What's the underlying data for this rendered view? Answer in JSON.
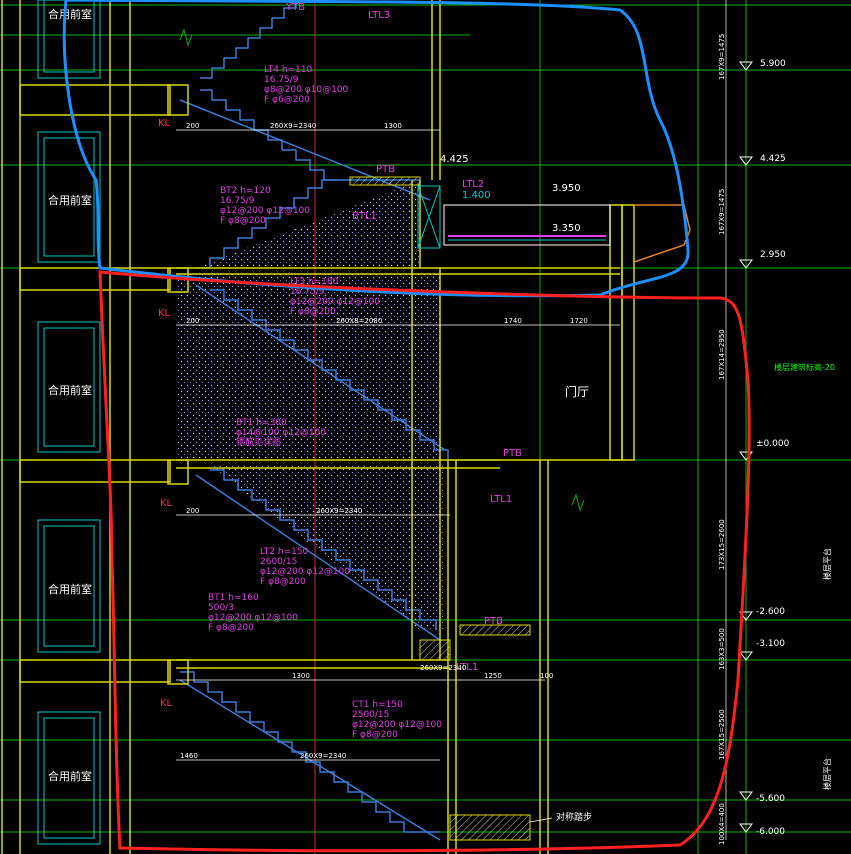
{
  "room_label": "合用前室",
  "hall_label": "门厅",
  "elevations": [
    "5.900",
    "4.425",
    "2.950",
    "±0.000",
    "-2.600",
    "-3.100",
    "-5.600",
    "-6.000"
  ],
  "inner_levels": [
    "4.425",
    "3.950",
    "3.350",
    "1.400"
  ],
  "beam_labels": {
    "ytb": "YTB",
    "ltl3": "LTL3",
    "ptb_upper": "PTB",
    "ltl2": "LTL2",
    "btl1": "BTL1",
    "ptb_mid": "PTB",
    "ltl1_mid": "LTL1",
    "ptb_low": "PTB",
    "ltl1_low": "LTL1",
    "kl": "KL"
  },
  "stair_notes": {
    "lt4": [
      "LT4 h=110",
      "16.75/9",
      "φ8@200 φ10@100",
      "F φ6@200"
    ],
    "bt2": [
      "BT2 h=120",
      "16.75/9",
      "φ12@200 φ12@100",
      "F φ8@200"
    ],
    "lt3": [
      "LT3 h=180",
      "16.75/9",
      "φ12@200 φ12@100",
      "F φ8@200"
    ],
    "bt1a": [
      "BT1 h=300",
      "φ14@100 φ12@100",
      "钢筋见详图"
    ],
    "lt2": [
      "LT2 h=150",
      "2600/15",
      "φ12@200 φ12@100",
      "F φ8@200"
    ],
    "bt1": [
      "BT1 h=160",
      "500/3",
      "φ12@200 φ12@100",
      "F φ8@200"
    ],
    "ct1": [
      "CT1 h=150",
      "2500/15",
      "φ12@200 φ12@100",
      "F φ8@200"
    ]
  },
  "dims": {
    "top_flight": "260X9=2340",
    "upper_flight": "260X8=2080",
    "mid_flight": "260X9=2340",
    "low_flight": "260X9=2340",
    "lowest_flight": "260X9=2340",
    "d1": "200",
    "d2": "1300",
    "d3": "1740",
    "d4": "1720",
    "d5": "1250",
    "d6": "1300",
    "d7": "1460",
    "d8": "100"
  },
  "side_dims": [
    "167X9=1475",
    "167X9=1475",
    "167X14=2950",
    "173X15=2600",
    "163X3=500",
    "167X15=2500",
    "100X4=400"
  ],
  "right_notes": [
    "楼层建筑标高-20",
    "楼层平台",
    "楼层平台"
  ],
  "bottom_note": "对称踏步",
  "colors": {
    "background": "#000000",
    "wall": "#d8d800",
    "stair": "#3b7bd4",
    "annotation": "#e040e0",
    "grid_green": "#00b400",
    "grid_cyan": "#00c8c8",
    "dim_white": "#ffffff",
    "highlight_blue": "#1e8fff",
    "highlight_red": "#ff2020",
    "axis_red": "#c03030"
  }
}
